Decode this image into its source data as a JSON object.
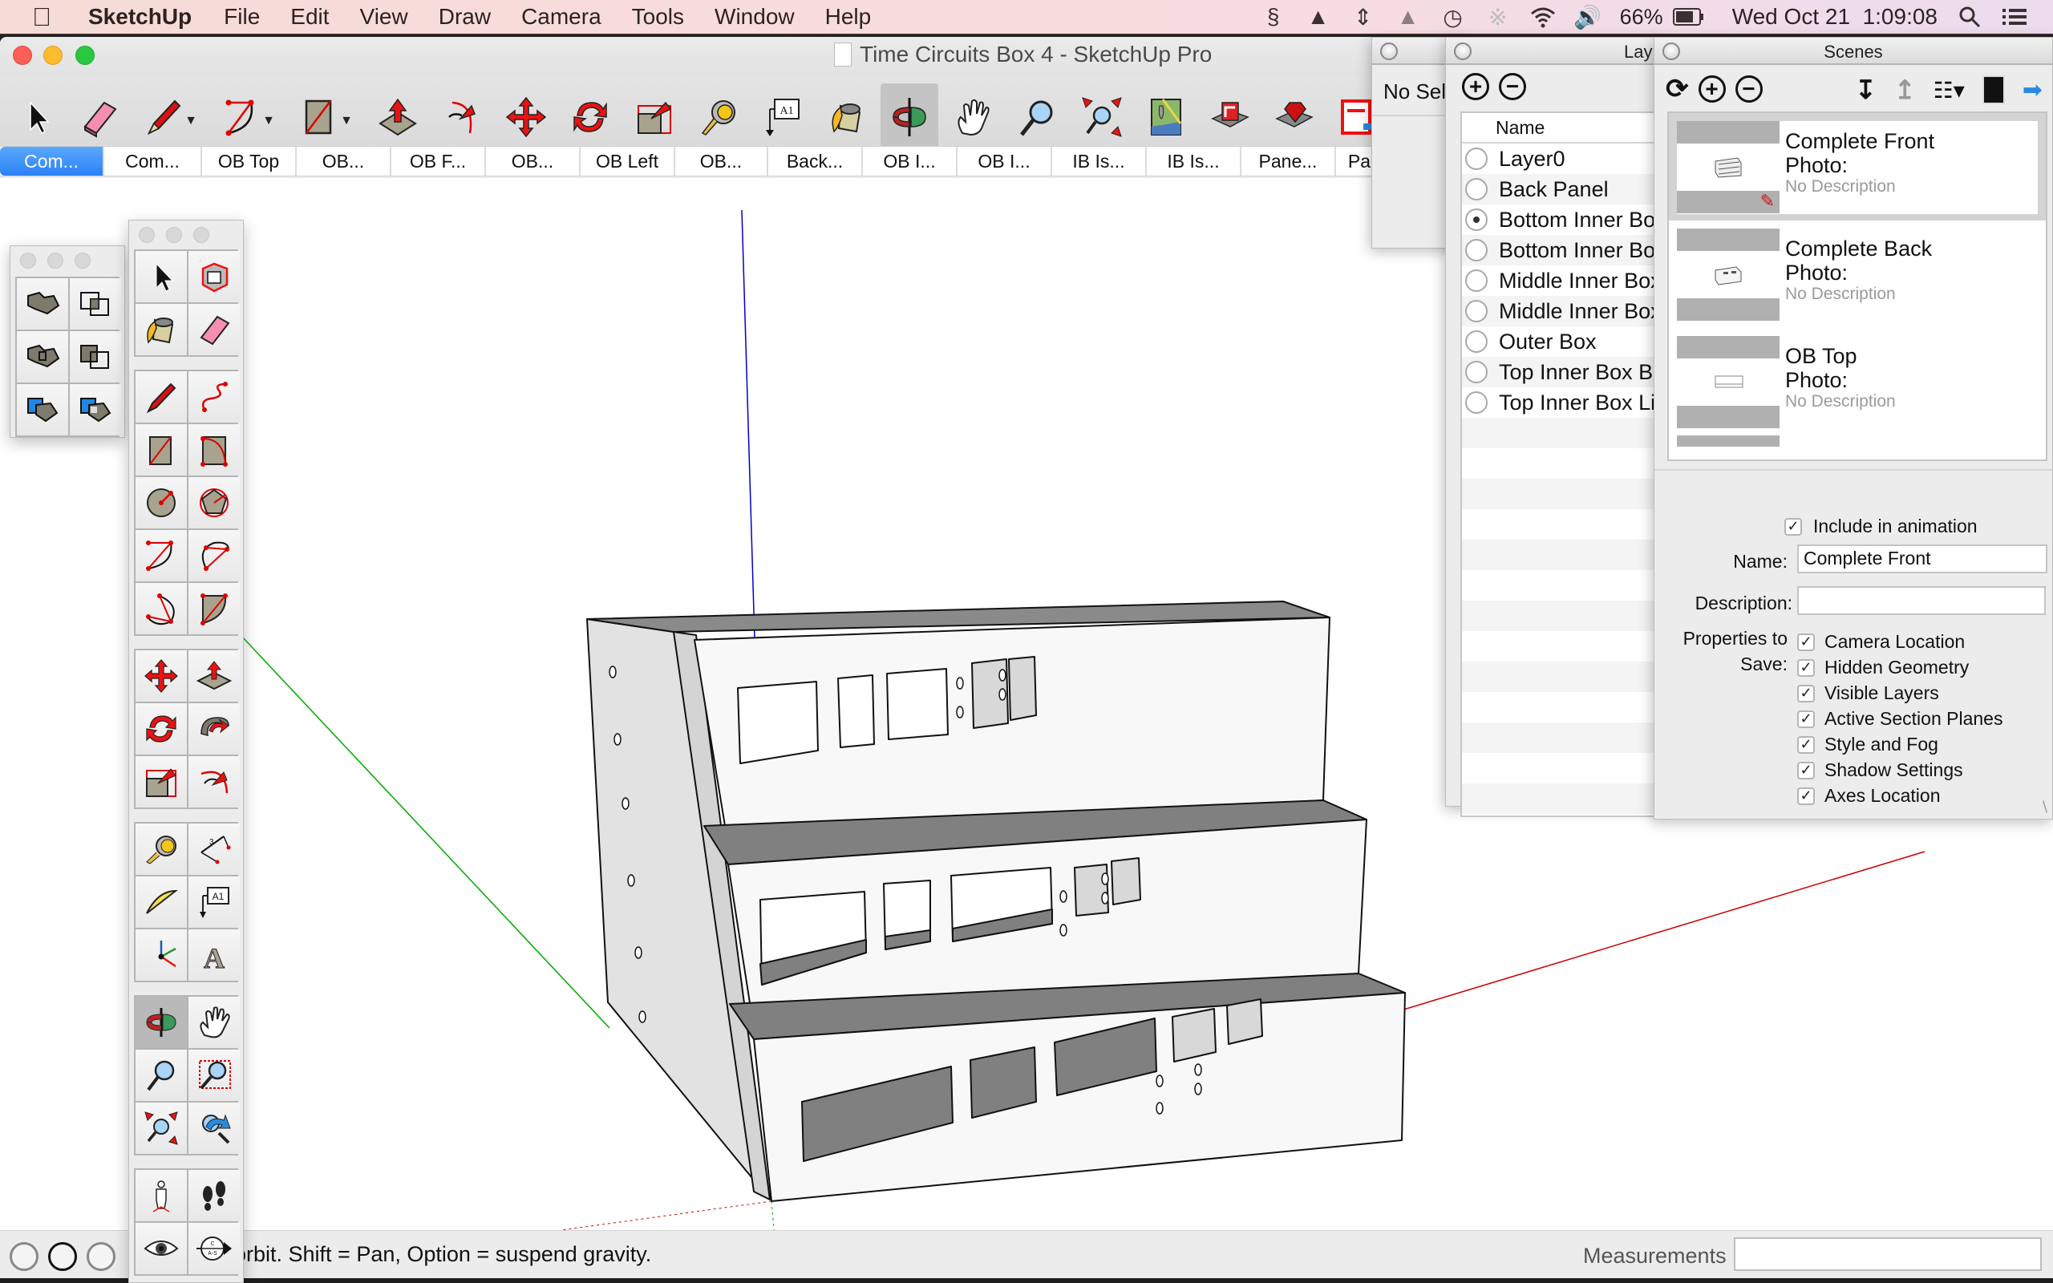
{
  "menubar": {
    "app_name": "SketchUp",
    "items": [
      "File",
      "Edit",
      "View",
      "Draw",
      "Camera",
      "Tools",
      "Window",
      "Help"
    ],
    "battery": "66%",
    "clock": "Wed Oct 21  1:09:08",
    "status_icons": [
      "scrivener-icon",
      "google-drive-icon",
      "move-icon",
      "notification-icon",
      "time-machine-icon",
      "bluetooth-icon",
      "wifi-icon",
      "volume-icon",
      "battery-icon",
      "spotlight-icon",
      "notification-center-icon"
    ]
  },
  "window": {
    "title": "Time Circuits Box 4 - SketchUp Pro"
  },
  "toolbar": {
    "tools": [
      {
        "name": "select"
      },
      {
        "name": "eraser"
      },
      {
        "name": "pencil",
        "dropdown": true
      },
      {
        "name": "arc",
        "dropdown": true
      },
      {
        "name": "rectangle",
        "dropdown": true
      },
      {
        "name": "push-pull"
      },
      {
        "name": "offset"
      },
      {
        "name": "move"
      },
      {
        "name": "rotate"
      },
      {
        "name": "scale"
      },
      {
        "name": "tape-measure"
      },
      {
        "name": "text"
      },
      {
        "name": "paint-bucket"
      },
      {
        "name": "orbit",
        "active": true
      },
      {
        "name": "pan"
      },
      {
        "name": "zoom"
      },
      {
        "name": "zoom-extents"
      },
      {
        "name": "add-location"
      },
      {
        "name": "3d-warehouse"
      },
      {
        "name": "extension-warehouse"
      },
      {
        "name": "layout"
      }
    ]
  },
  "scene_tabs": [
    {
      "label": "Com...",
      "active": true
    },
    {
      "label": "Com..."
    },
    {
      "label": "OB Top"
    },
    {
      "label": "OB..."
    },
    {
      "label": "OB F..."
    },
    {
      "label": "OB..."
    },
    {
      "label": "OB Left"
    },
    {
      "label": "OB..."
    },
    {
      "label": "Back..."
    },
    {
      "label": "OB I..."
    },
    {
      "label": "OB I..."
    },
    {
      "label": "IB Is..."
    },
    {
      "label": "IB Is..."
    },
    {
      "label": "Pane..."
    },
    {
      "label": "Pa"
    }
  ],
  "entity_info": {
    "text": "No Sele"
  },
  "layers": {
    "title": "Lay",
    "column_header": "Name",
    "items": [
      {
        "name": "Layer0",
        "active": false
      },
      {
        "name": "Back Panel",
        "active": false
      },
      {
        "name": "Bottom Inner Bo",
        "active": true
      },
      {
        "name": "Bottom Inner Bo",
        "active": false
      },
      {
        "name": "Middle Inner Box",
        "active": false
      },
      {
        "name": "Middle Inner Box",
        "active": false
      },
      {
        "name": "Outer Box",
        "active": false
      },
      {
        "name": "Top Inner Box B",
        "active": false
      },
      {
        "name": "Top Inner Box Li",
        "active": false
      }
    ]
  },
  "scenes": {
    "title": "Scenes",
    "list": [
      {
        "name": "Complete Front",
        "photo": "Photo:",
        "description": "No Description",
        "active": true
      },
      {
        "name": "Complete Back",
        "photo": "Photo:",
        "description": "No Description",
        "active": false
      },
      {
        "name": "OB Top",
        "photo": "Photo:",
        "description": "No Description",
        "active": false
      }
    ],
    "include_in_animation": {
      "label": "Include in animation",
      "checked": true
    },
    "name_label": "Name:",
    "name_value": "Complete Front",
    "description_label": "Description:",
    "description_value": "",
    "properties_label_1": "Properties to",
    "properties_label_2": "Save:",
    "properties": [
      {
        "label": "Camera Location",
        "checked": true
      },
      {
        "label": "Hidden Geometry",
        "checked": true
      },
      {
        "label": "Visible Layers",
        "checked": true
      },
      {
        "label": "Active Section Planes",
        "checked": true
      },
      {
        "label": "Style and Fog",
        "checked": true
      },
      {
        "label": "Shadow Settings",
        "checked": true
      },
      {
        "label": "Axes Location",
        "checked": true
      }
    ]
  },
  "status": {
    "hint": "orbit. Shift = Pan, Option = suspend gravity.",
    "measurements_label": "Measurements",
    "measurements_value": ""
  },
  "colors": {
    "accent": "#2b82f6",
    "axis_red": "#cc0000",
    "axis_green": "#00aa00",
    "axis_blue": "#0000cc",
    "face_gray": "#808080"
  }
}
